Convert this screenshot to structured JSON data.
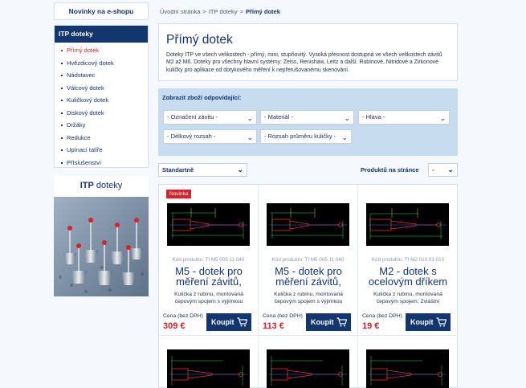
{
  "sidebar": {
    "eshop_news": "Novinky na e-shopu",
    "category_title": "ITP doteky",
    "items": [
      {
        "label": "Přímý dotek",
        "active": true
      },
      {
        "label": "Hvězdicový dotek"
      },
      {
        "label": "Nádstavec"
      },
      {
        "label": "Válcový dotek"
      },
      {
        "label": "Kuličkový dotek"
      },
      {
        "label": "Diskový dotek"
      },
      {
        "label": "Držáky"
      },
      {
        "label": "Redukce"
      },
      {
        "label": "Upínací talíře"
      },
      {
        "label": "Příslušenství"
      }
    ],
    "promo": {
      "brand_bold": "ITP",
      "brand_light": " doteky"
    }
  },
  "breadcrumb": {
    "home": "Úvodní stránka",
    "sep": ">",
    "parent": "ITP doteky",
    "current": "Přímý dotek"
  },
  "intro": {
    "title": "Přímý dotek",
    "text": "Doteky ITP ve všech velikostech - přímý, mini, stupňovitý. Vysoká přesnost dostupná ve všech velikostech závitů M2 až M6. Doteky pro všechny hlavní systémy: Zeiss, Renishaw, Leitz a další. Rubínové, Nitridové a Zirkonové kuličky pro aplikace od dotykového měření k nepřerušovanému skenování."
  },
  "filter": {
    "title": "Zobrazit zboží odpovídající:",
    "selects": [
      "- Označení závitu -",
      "- Materiál -",
      "- Hlava -",
      "- Délkový rozsah -",
      "- Rozsah průměru kuličky -"
    ]
  },
  "sorting": {
    "sort_value": "Standartně",
    "per_page_label": "Produktů na stránce",
    "per_page_value": "-"
  },
  "products": [
    {
      "badge": "Novinka",
      "code": "Kód produktu:  TI M5 005 11 040",
      "name": "M5 - dotek pro měření závitů,",
      "desc": "Kulička z rubínu, montovaná čepovým spojem s výjimkou",
      "price_label": "Cena (bez DPH)",
      "price": "309 €",
      "buy": "Koupit"
    },
    {
      "code": "Kód produktu:  TI M5 005 11 040",
      "name": "M5 - dotek pro měření závitů,",
      "desc": "Kulička z rubínu, montovaná čepovým spojem s výjimkou",
      "price_label": "Cena (bez DPH)",
      "price": "113 €",
      "buy": "Koupit"
    },
    {
      "code": "Kód produktu:  TI M2 010 03 010",
      "name": "M2 - dotek s ocelovým dříkem",
      "desc": "Kulička z rubínu, montovaná čepovým spojem. Zvláštní",
      "price_label": "Cena (bez DPH)",
      "price": "19 €",
      "buy": "Koupit"
    }
  ],
  "colors": {
    "navy": "#13366e",
    "red": "#d8222b",
    "filter_bg": "#c8dcf0"
  }
}
